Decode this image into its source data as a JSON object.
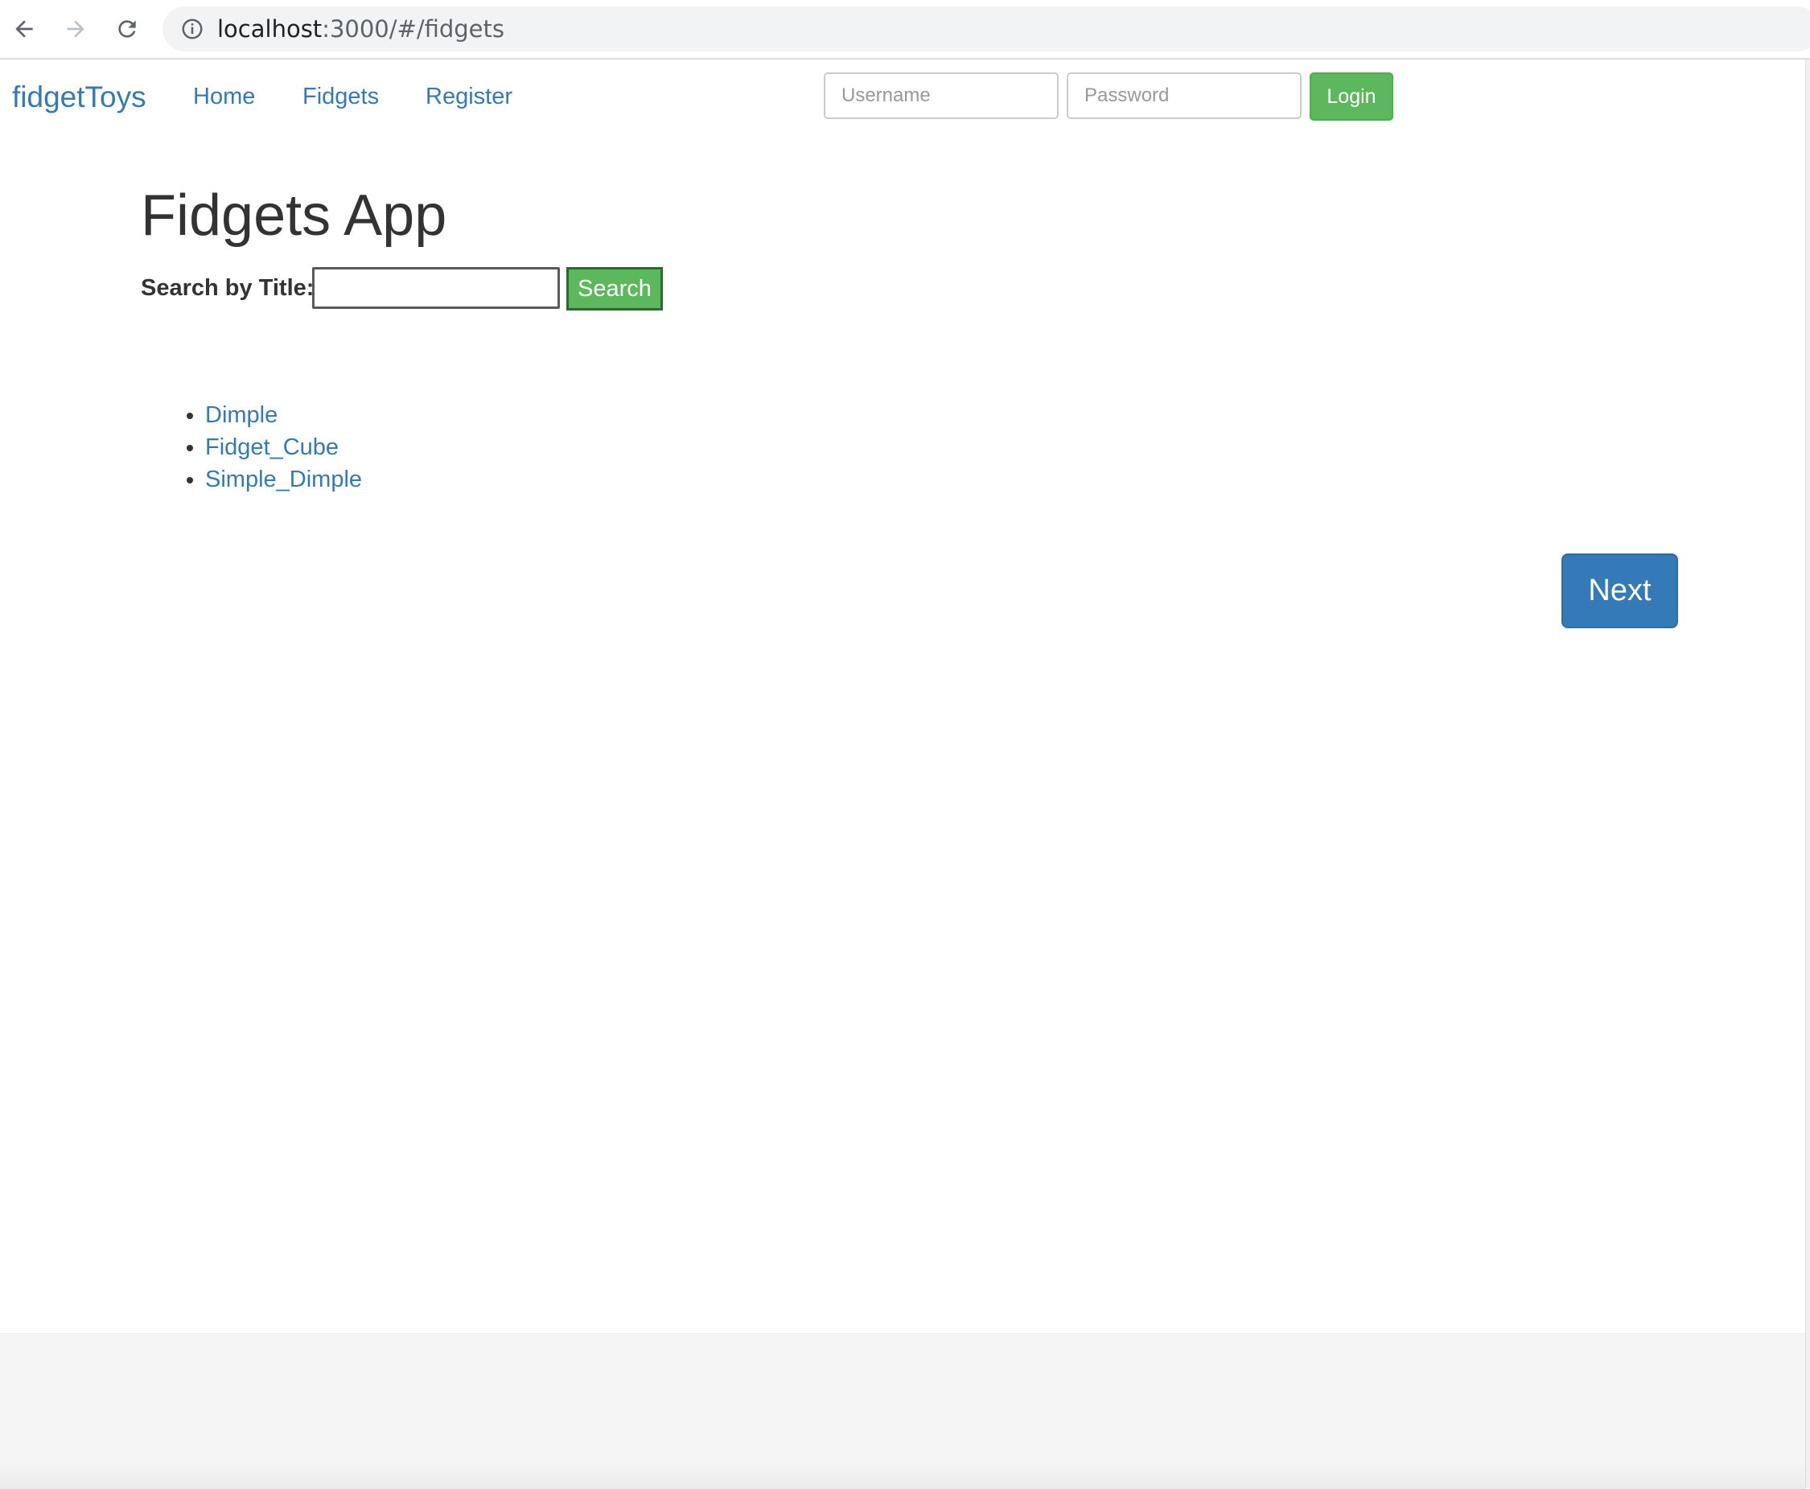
{
  "browser": {
    "url_host": "localhost",
    "url_path": ":3000/#/fidgets"
  },
  "navbar": {
    "brand": "fidgetToys",
    "links": [
      "Home",
      "Fidgets",
      "Register"
    ],
    "username_placeholder": "Username",
    "password_placeholder": "Password",
    "login_label": "Login"
  },
  "main": {
    "title": "Fidgets App",
    "search_label": "Search by Title:",
    "search_value": "",
    "search_button": "Search",
    "fidgets": [
      "Dimple",
      "Fidget_Cube",
      "Simple_Dimple"
    ],
    "next_button": "Next"
  },
  "colors": {
    "link": "#337ab7",
    "success": "#5cb85c",
    "primary": "#337ab7"
  },
  "icons": [
    "back-arrow-icon",
    "forward-arrow-icon",
    "reload-icon",
    "info-icon"
  ]
}
